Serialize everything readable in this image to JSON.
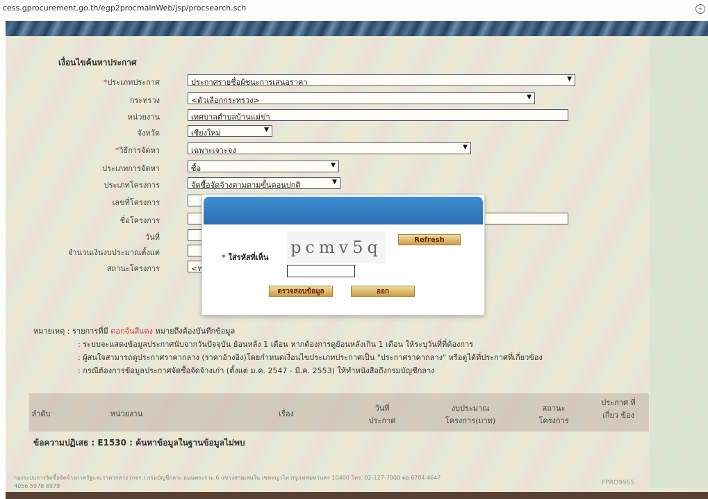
{
  "browser": {
    "url": "cess.gprocurement.go.th/egp2procmainWeb/jsp/procsearch.sch"
  },
  "form": {
    "title": "เงื่อนไขค้นหาประกาศ",
    "fields": [
      {
        "label": "ประเภทประกาศ",
        "required": true,
        "value": "ประกาศรายชื่อผู้ชนะการเสนอราคา",
        "type": "select"
      },
      {
        "label": "กระทรวง",
        "required": false,
        "value": "<ตัวเลือกกระทรวง>",
        "type": "select"
      },
      {
        "label": "หน่วยงาน",
        "required": false,
        "value": "เทศบาลตำบลบ้านแม่ข่า",
        "type": "text"
      },
      {
        "label": "จังหวัด",
        "required": false,
        "value": "เชียงใหม่",
        "type": "select"
      },
      {
        "label": "วิธีการจัดหา",
        "required": true,
        "value": "เฉพาะเจาะจง",
        "type": "select"
      },
      {
        "label": "ประเภทการจัดหา",
        "required": false,
        "value": "ซื้อ",
        "type": "select"
      },
      {
        "label": "ประเภทโครงการ",
        "required": false,
        "value": "จัดซื้อจัดจ้างตามตามขั้นตอนปกติ",
        "type": "select"
      },
      {
        "label": "เลขที่โครงการ",
        "required": false,
        "value": "",
        "type": "text"
      },
      {
        "label": "ชื่อโครงการ",
        "required": false,
        "value": "",
        "type": "text"
      },
      {
        "label": "วันที่",
        "required": false,
        "value": "",
        "type": "text"
      },
      {
        "label": "จำนวนเงินงบประมาณตั้งแต่",
        "required": false,
        "value": "",
        "type": "text"
      },
      {
        "label": "สถานะโครงการ",
        "required": false,
        "value": "<ท",
        "type": "select"
      }
    ]
  },
  "captcha": {
    "label": "ใส่รหัสที่เห็น",
    "required_mark": "*",
    "code_text": "pcmv5q",
    "refresh_label": "Refresh",
    "verify_label": "ตรวจสอบข้อมูล",
    "cancel_label": "ออก",
    "input_value": ""
  },
  "notes": {
    "prefix": "หมายเหตุ : รายการที่มี ",
    "highlight": "ดอกจันสีแดง",
    "suffix": " หมายถึงต้องบันทึกข้อมูล",
    "lines": [
      ": ระบบจะแสดงข้อมูลประกาศนับจากวันปัจจุบัน ย้อนหลัง 1 เดือน หากต้องการดูย้อนหลังเกิน 1 เดือน ให้ระบุวันที่ที่ต้องการ",
      ": ผู้สนใจสามารถดูประกาศราคากลาง (ราคาอ้างอิง)โดยกำหนดเงื่อนไขประเภทประกาศเป็น \"ประกาศราคากลาง\" หรือดูได้ที่ประกาศที่เกี่ยวข้อง",
      ": กรณีต้องการข้อมูลประกาศจัดซื้อจัดจ้างเก่า (ตั้งแต่ ม.ค. 2547 - มี.ค. 2553) ให้ทำหนังสือถึงกรมบัญชีกลาง"
    ]
  },
  "table": {
    "headers": [
      "ลำดับ",
      "หน่วยงาน",
      "เรื่อง",
      "วันที่ ประกาศ",
      "งบประมาณ โครงการ(บาท)",
      "สถานะ โครงการ",
      "ประกาศ ที่เกี่ยว ข้อง"
    ]
  },
  "error_message": "ข้อความปฏิเสธ : E1530 : ค้นหาข้อมูลในฐานข้อมูลไม่พบ",
  "footer": {
    "text": "กองระบบการจัดซื้อจัดจ้างภาครัฐและราคากลาง (กจร.) กรมบัญชีกลาง ถนนพระราม 6 แขวงสามเสนใน เขตพญาไท กรุงเทพมหานคร 10400 โทร. 02-127-7000 ต่อ 6704 4647",
    "text2": "4056 5978 6979",
    "code": "FPRO9965"
  }
}
